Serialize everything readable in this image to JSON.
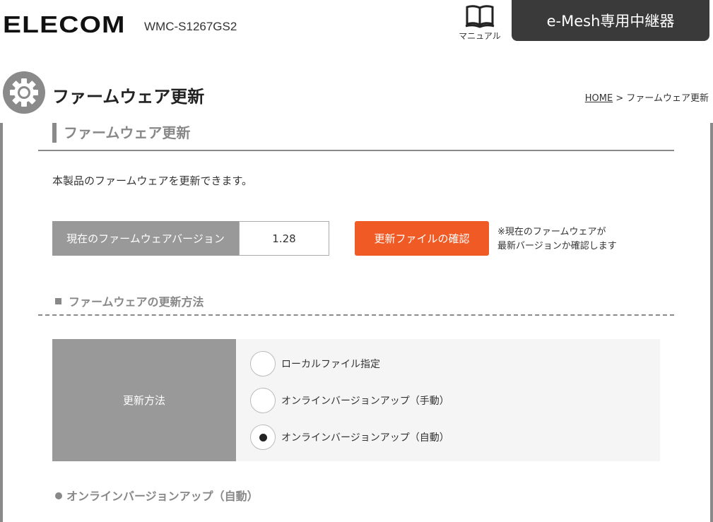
{
  "header": {
    "logo": "ELECOM",
    "model": "WMC-S1267GS2",
    "manual_label": "マニュアル",
    "mesh_button": "e-Mesh専用中継器"
  },
  "page": {
    "title": "ファームウェア更新",
    "breadcrumb_home": "HOME",
    "breadcrumb_sep": " > ",
    "breadcrumb_current": "ファームウェア更新"
  },
  "section": {
    "title": "ファームウェア更新",
    "description": "本製品のファームウェアを更新できます。",
    "fw_version_label": "現在のファームウェアバージョン",
    "fw_version_value": "1.28",
    "check_button": "更新ファイルの確認",
    "note_line1": "※現在のファームウェアが",
    "note_line2": "最新バージョンか確認します"
  },
  "update_method": {
    "title": "ファームウェアの更新方法",
    "label": "更新方法",
    "options": [
      {
        "label": "ローカルファイル指定",
        "selected": false
      },
      {
        "label": "オンラインバージョンアップ（手動）",
        "selected": false
      },
      {
        "label": "オンラインバージョンアップ（自動）",
        "selected": true
      }
    ]
  },
  "auto_section": {
    "title": "オンラインバージョンアップ（自動）"
  },
  "colors": {
    "accent": "#f05a24",
    "dark_button": "#3a3a3a",
    "label_bg": "#999999"
  }
}
